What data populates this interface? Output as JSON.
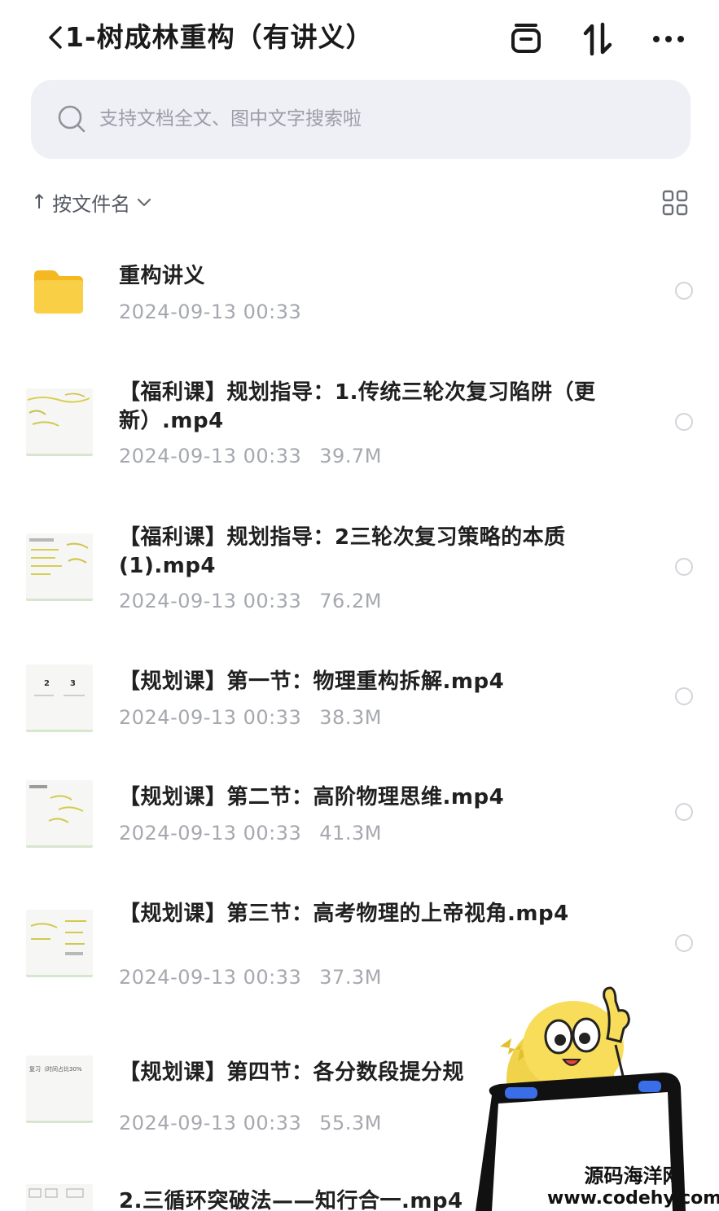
{
  "header": {
    "title": "1-树成林重构（有讲义）",
    "back_icon": "chevron-left-icon",
    "actions": [
      {
        "name": "archive-icon"
      },
      {
        "name": "sort-arrows-icon"
      },
      {
        "name": "more-icon"
      }
    ]
  },
  "search": {
    "placeholder": "支持文档全文、图中文字搜索啦",
    "icon": "search-icon"
  },
  "sort": {
    "arrow": "↑",
    "label": "按文件名",
    "chevron": "chevron-down-icon",
    "view_toggle_icon": "grid-view-icon"
  },
  "files": [
    {
      "name": "重构讲义",
      "date": "2024-09-13 00:33",
      "size": "",
      "type": "folder"
    },
    {
      "name": "【福利课】规划指导：1.传统三轮次复习陷阱（更新）.mp4",
      "date": "2024-09-13 00:33",
      "size": "39.7M",
      "type": "video"
    },
    {
      "name": "【福利课】规划指导：2三轮次复习策略的本质 (1).mp4",
      "date": "2024-09-13 00:33",
      "size": "76.2M",
      "type": "video"
    },
    {
      "name": "【规划课】第一节：物理重构拆解.mp4",
      "date": "2024-09-13 00:33",
      "size": "38.3M",
      "type": "video"
    },
    {
      "name": "【规划课】第二节：高阶物理思维.mp4",
      "date": "2024-09-13 00:33",
      "size": "41.3M",
      "type": "video"
    },
    {
      "name": "【规划课】第三节：高考物理的上帝视角.mp4",
      "date": "2024-09-13 00:33",
      "size": "37.3M",
      "type": "video"
    },
    {
      "name": "【规划课】第四节：各分数段提分规",
      "date": "2024-09-13 00:33",
      "size": "55.3M",
      "type": "video"
    },
    {
      "name": "2.三循环突破法——知行合一.mp4",
      "date": "",
      "size": "",
      "type": "video"
    }
  ],
  "thumb_text": {
    "t3a": "2",
    "t3b": "3",
    "t6": "复习（时间占比30%"
  },
  "watermark": {
    "line1": "源码海洋网",
    "line2": "www.codehy.com"
  },
  "colors": {
    "accent_folder": "#F7C531",
    "search_bg": "#EEF0F5",
    "meta_text": "#A5A8AE"
  }
}
